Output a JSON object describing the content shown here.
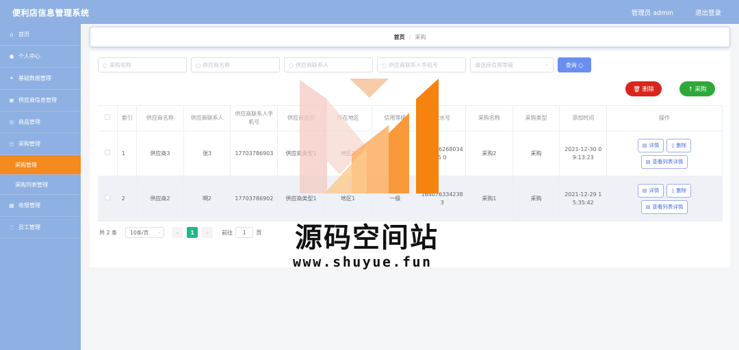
{
  "header": {
    "title": "便利店信息管理系统",
    "user": "管理员 admin",
    "logout": "退出登录"
  },
  "sidebar": {
    "items": [
      {
        "icon": "⌂",
        "label": "首页"
      },
      {
        "icon": "●",
        "label": "个人中心"
      },
      {
        "icon": "✦",
        "label": "基础数据管理"
      },
      {
        "icon": "▣",
        "label": "供应商信息管理"
      },
      {
        "icon": "◎",
        "label": "商品管理"
      },
      {
        "icon": "◷",
        "label": "采购管理"
      },
      {
        "icon": "",
        "label": "采购管理"
      },
      {
        "icon": "",
        "label": "采购列表管理"
      },
      {
        "icon": "▦",
        "label": "收银管理"
      },
      {
        "icon": "◌",
        "label": "员工管理"
      }
    ]
  },
  "breadcrumb": {
    "home": "首页",
    "sep": "/",
    "current": "采购"
  },
  "search": {
    "purchase_name": "采购名称",
    "supplier_name": "供应商名称",
    "contact": "供应商联系人",
    "contact_phone": "供应商联系人手机号",
    "credit_select": "请选择信用等级",
    "query_label": "查询 ○"
  },
  "actions": {
    "delete": "🗑 删除",
    "purchase": "↑ 采购"
  },
  "table": {
    "headers": [
      "",
      "索引",
      "供应商名称",
      "供应商联系人",
      "供应商联系人手机号",
      "供应商类型",
      "所在地区",
      "信用等级",
      "流水号",
      "采购名称",
      "采购类型",
      "添加时间",
      "操作"
    ],
    "rows": [
      [
        "",
        "1",
        "供应商3",
        "张3",
        "17703786903",
        "供应商类型1",
        "地区2",
        "一级",
        "1640762680345 0",
        "采购2",
        "采购",
        "2021-12-30 09:13:23"
      ],
      [
        "",
        "2",
        "供应商2",
        "啊2",
        "17703786902",
        "供应商类型1",
        "地区1",
        "一级",
        "1640763342383",
        "采购1",
        "采购",
        "2021-12-29 15:35:42"
      ]
    ],
    "op_detail": "详情",
    "op_delete": "删除",
    "op_list_detail": "查看列表详情"
  },
  "pager": {
    "total": "共 2 条",
    "size": "10条/页",
    "prev": "‹",
    "page": "1",
    "next": "›",
    "goto": "前往",
    "goto_value": "1",
    "page_suffix": "页"
  },
  "watermark": {
    "text": "源码空间站",
    "url": "www.shuyue.fun"
  },
  "colors": {
    "header": "#8fb0e2",
    "active_menu": "#f58a1f",
    "query": "#6a8df0",
    "delete": "#d9261c",
    "purchase": "#2fa83a",
    "page_active": "#1fb88a"
  }
}
